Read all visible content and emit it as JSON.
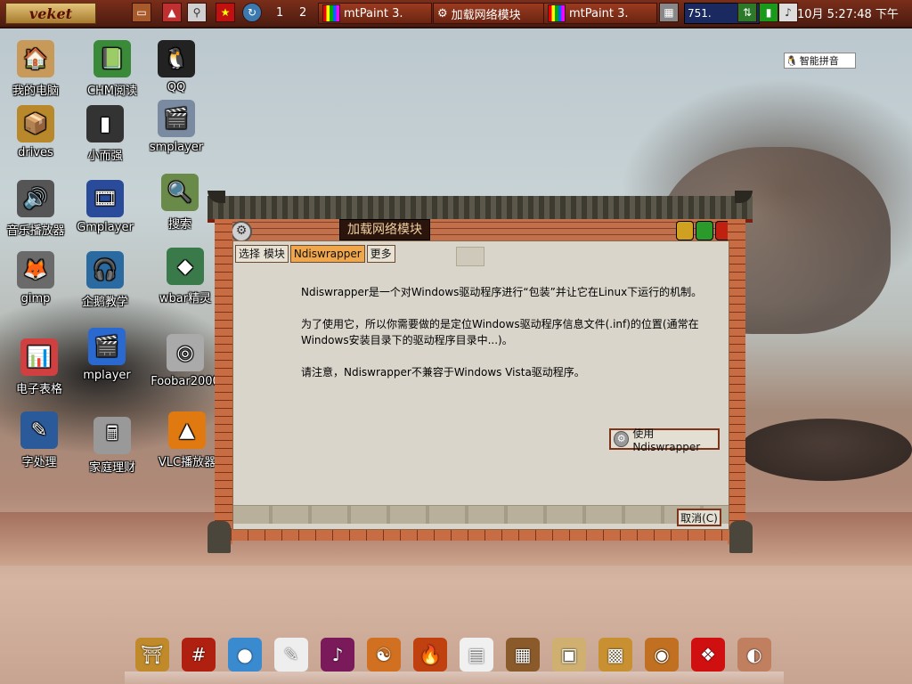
{
  "top_panel": {
    "menu_label": "veket",
    "workspaces": [
      "1",
      "2"
    ],
    "tasks": [
      {
        "label": "mtPaint 3."
      },
      {
        "label": "加载网络模块"
      },
      {
        "label": "mtPaint 3."
      }
    ],
    "cpu_value": "751.",
    "clock": "10月 5:27:48 下午"
  },
  "ime": {
    "label": "智能拼音"
  },
  "desktop_icons": [
    {
      "label": "我的电脑",
      "icon": "house-icon",
      "glyph": "🏠",
      "color": "#c89a5a"
    },
    {
      "label": "CHM阅读",
      "icon": "book-icon",
      "glyph": "📗",
      "color": "#3a8a3a"
    },
    {
      "label": "QQ",
      "icon": "penguin-icon",
      "glyph": "🐧",
      "color": "#222222"
    },
    {
      "label": "drives",
      "icon": "boxes-icon",
      "glyph": "📦",
      "color": "#b8882a"
    },
    {
      "label": "小而强",
      "icon": "usb-stick-icon",
      "glyph": "▮",
      "color": "#333333"
    },
    {
      "label": "smplayer",
      "icon": "film-reel-icon",
      "glyph": "🎬",
      "color": "#7a8aa0"
    },
    {
      "label": "音乐播放器",
      "icon": "speaker-icon",
      "glyph": "🔊",
      "color": "#555555"
    },
    {
      "label": "Gmplayer",
      "icon": "clapper-icon",
      "glyph": "🎞",
      "color": "#2a4a9a"
    },
    {
      "label": "搜索",
      "icon": "search-photo-icon",
      "glyph": "🔍",
      "color": "#6a8a4a"
    },
    {
      "label": "gimp",
      "icon": "gimp-icon",
      "glyph": "🦊",
      "color": "#6a6a6a"
    },
    {
      "label": "企鹅教学",
      "icon": "tux-headphones-icon",
      "glyph": "🎧",
      "color": "#2a6aa0"
    },
    {
      "label": "wbar精灵",
      "icon": "kite-icon",
      "glyph": "◆",
      "color": "#3a7a4a"
    },
    {
      "label": "电子表格",
      "icon": "spreadsheet-icon",
      "glyph": "📊",
      "color": "#d04040"
    },
    {
      "label": "mplayer",
      "icon": "clapper-blue-icon",
      "glyph": "🎬",
      "color": "#2a6ad0"
    },
    {
      "label": "Foobar2000",
      "icon": "speakers-icon",
      "glyph": "◎",
      "color": "#aaaaaa"
    },
    {
      "label": "字处理",
      "icon": "writer-icon",
      "glyph": "✎",
      "color": "#2a5a9a"
    },
    {
      "label": "家庭理财",
      "icon": "calculator-icon",
      "glyph": "🖩",
      "color": "#999999"
    },
    {
      "label": "VLC播放器",
      "icon": "vlc-cone-icon",
      "glyph": "▲",
      "color": "#e07a10"
    }
  ],
  "dialog": {
    "title": "加载网络模块",
    "tabs": [
      "选择 模块",
      "Ndiswrapper",
      "更多"
    ],
    "active_tab": 1,
    "paragraphs": [
      "Ndiswrapper是一个对Windows驱动程序进行“包装”并让它在Linux下运行的机制。",
      "为了使用它，所以你需要做的是定位Windows驱动程序信息文件(.inf)的位置(通常在Windows安装目录下的驱动程序目录中...)。",
      "请注意，Ndiswrapper不兼容于Windows Vista驱动程序。"
    ],
    "use_button": "使用Ndiswrapper",
    "cancel_button": "取消(C)"
  },
  "dock": [
    {
      "icon": "palace-icon",
      "glyph": "⛩",
      "color": "#c08a2a"
    },
    {
      "icon": "red-book-icon",
      "glyph": "#",
      "color": "#b02010"
    },
    {
      "icon": "globe-icon",
      "glyph": "●",
      "color": "#3a8ad0"
    },
    {
      "icon": "notepad-icon",
      "glyph": "✎",
      "color": "#eeeeee"
    },
    {
      "icon": "music-disc-icon",
      "glyph": "♪",
      "color": "#7a1a5a"
    },
    {
      "icon": "yin-yang-icon",
      "glyph": "☯",
      "color": "#d07020"
    },
    {
      "icon": "fire-icon",
      "glyph": "🔥",
      "color": "#c04010"
    },
    {
      "icon": "document-icon",
      "glyph": "▤",
      "color": "#f0f0f0"
    },
    {
      "icon": "abacus-icon",
      "glyph": "▦",
      "color": "#8a5a2a"
    },
    {
      "icon": "painting-icon",
      "glyph": "▣",
      "color": "#d0b070"
    },
    {
      "icon": "package-icon",
      "glyph": "▩",
      "color": "#c89030"
    },
    {
      "icon": "mooncake-icon",
      "glyph": "◉",
      "color": "#c07020"
    },
    {
      "icon": "chinese-knot-icon",
      "glyph": "❖",
      "color": "#d01010"
    },
    {
      "icon": "fan-icon",
      "glyph": "◐",
      "color": "#c08060"
    }
  ],
  "colors": {
    "panel": "#5a2212",
    "brick": "#c86c44",
    "active_tab": "#f0a64a",
    "title_text": "#f0d2a0"
  }
}
